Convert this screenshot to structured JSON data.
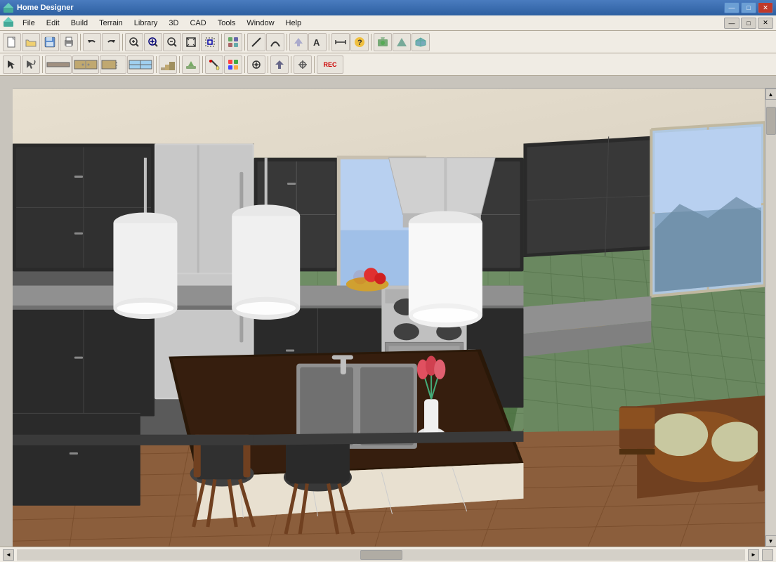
{
  "app": {
    "title": "Home Designer",
    "icon": "home-icon"
  },
  "window_controls": {
    "minimize": "—",
    "maximize": "□",
    "close": "✕",
    "min2": "—",
    "max2": "□",
    "close2": "✕"
  },
  "menu": {
    "items": [
      {
        "id": "file",
        "label": "File"
      },
      {
        "id": "edit",
        "label": "Edit"
      },
      {
        "id": "build",
        "label": "Build"
      },
      {
        "id": "terrain",
        "label": "Terrain"
      },
      {
        "id": "library",
        "label": "Library"
      },
      {
        "id": "3d",
        "label": "3D"
      },
      {
        "id": "cad",
        "label": "CAD"
      },
      {
        "id": "tools",
        "label": "Tools"
      },
      {
        "id": "window",
        "label": "Window"
      },
      {
        "id": "help",
        "label": "Help"
      }
    ]
  },
  "toolbar1": {
    "buttons": [
      {
        "id": "new",
        "icon": "📄",
        "tooltip": "New"
      },
      {
        "id": "open",
        "icon": "📂",
        "tooltip": "Open"
      },
      {
        "id": "save",
        "icon": "💾",
        "tooltip": "Save"
      },
      {
        "id": "print",
        "icon": "🖨",
        "tooltip": "Print"
      },
      {
        "id": "undo",
        "icon": "↩",
        "tooltip": "Undo"
      },
      {
        "id": "redo",
        "icon": "↪",
        "tooltip": "Redo"
      },
      {
        "id": "zoom-in",
        "icon": "🔍+",
        "tooltip": "Zoom In"
      },
      {
        "id": "zoom-in2",
        "icon": "⊕",
        "tooltip": "Zoom In"
      },
      {
        "id": "zoom-out",
        "icon": "⊖",
        "tooltip": "Zoom Out"
      },
      {
        "id": "zoom-fit",
        "icon": "⊞",
        "tooltip": "Zoom to Fit"
      },
      {
        "id": "zoom-sel",
        "icon": "⊡",
        "tooltip": "Zoom to Selection"
      },
      {
        "id": "add",
        "icon": "+",
        "tooltip": "Add"
      },
      {
        "id": "line",
        "icon": "╱",
        "tooltip": "Line"
      },
      {
        "id": "arc",
        "icon": "⌒",
        "tooltip": "Arc"
      },
      {
        "id": "text",
        "icon": "A",
        "tooltip": "Text"
      },
      {
        "id": "dim",
        "icon": "⟺",
        "tooltip": "Dimension"
      },
      {
        "id": "help2",
        "icon": "?",
        "tooltip": "Help"
      },
      {
        "id": "camera",
        "icon": "🏠",
        "tooltip": "Camera"
      },
      {
        "id": "elevation",
        "icon": "🏔",
        "tooltip": "Elevation"
      },
      {
        "id": "house",
        "icon": "🏡",
        "tooltip": "House"
      }
    ]
  },
  "toolbar2": {
    "buttons": [
      {
        "id": "select",
        "icon": "↖",
        "tooltip": "Select"
      },
      {
        "id": "arc2",
        "icon": "⌒",
        "tooltip": "Arc"
      },
      {
        "id": "wall",
        "icon": "▬",
        "tooltip": "Wall"
      },
      {
        "id": "cabinet",
        "icon": "▦",
        "tooltip": "Cabinet"
      },
      {
        "id": "door",
        "icon": "🚪",
        "tooltip": "Door"
      },
      {
        "id": "window2",
        "icon": "▣",
        "tooltip": "Window"
      },
      {
        "id": "stair",
        "icon": "▤",
        "tooltip": "Stair"
      },
      {
        "id": "terrain2",
        "icon": "⛰",
        "tooltip": "Terrain"
      },
      {
        "id": "paint",
        "icon": "✎",
        "tooltip": "Paint"
      },
      {
        "id": "material",
        "icon": "≡",
        "tooltip": "Material"
      },
      {
        "id": "symbol",
        "icon": "◈",
        "tooltip": "Symbol"
      },
      {
        "id": "arrow",
        "icon": "↑",
        "tooltip": "Arrow"
      },
      {
        "id": "transform",
        "icon": "⊹",
        "tooltip": "Transform"
      },
      {
        "id": "record",
        "icon": "REC",
        "tooltip": "Record"
      }
    ]
  },
  "status_bar": {
    "message": ""
  }
}
